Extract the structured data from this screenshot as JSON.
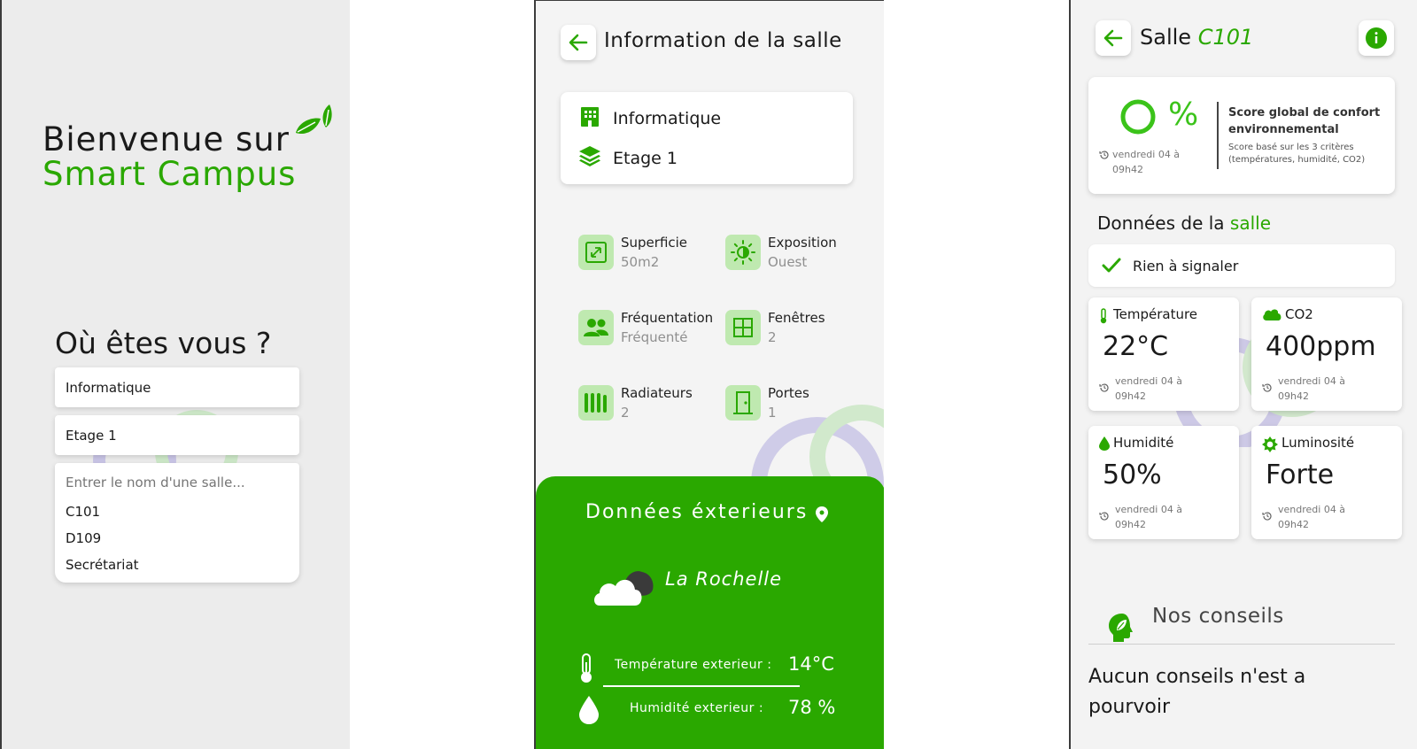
{
  "screen1": {
    "welcome_line1": "Bienvenue sur",
    "welcome_line2": "Smart Campus",
    "question": "Où êtes vous ?",
    "building_value": "Informatique",
    "floor_value": "Etage 1",
    "search_placeholder": "Entrer le nom d'une salle...",
    "options": [
      "C101",
      "D109",
      "Secrétariat"
    ]
  },
  "screen2": {
    "title": "Information de la salle",
    "building": "Informatique",
    "floor": "Etage 1",
    "stats": [
      {
        "label": "Superficie",
        "value": "50m2",
        "icon": "area-icon"
      },
      {
        "label": "Exposition",
        "value": "Ouest",
        "icon": "sun-icon"
      },
      {
        "label": "Fréquentation",
        "value": "Fréquenté",
        "icon": "people-icon"
      },
      {
        "label": "Fenêtres",
        "value": "2",
        "icon": "window-icon"
      },
      {
        "label": "Radiateurs",
        "value": "2",
        "icon": "radiator-icon"
      },
      {
        "label": "Portes",
        "value": "1",
        "icon": "door-icon"
      }
    ],
    "exterior": {
      "title": "Données éxterieurs",
      "city": "La Rochelle",
      "temp_label": "Température exterieur :",
      "temp_value": "14°C",
      "hum_label": "Humidité exterieur :",
      "hum_value": "78 %"
    }
  },
  "screen3": {
    "title_prefix": "Salle",
    "room": "C101",
    "score_symbol": "%",
    "score_time_line1": "vendredi 04 à",
    "score_time_line2": "09h42",
    "score_title": "Score global de confort environnemental",
    "score_subtitle": "Score basé sur les 3 critères (températures, humidité, CO2)",
    "data_title_prefix": "Données de la",
    "data_title_suffix": "salle",
    "status": "Rien à signaler",
    "sensors": [
      {
        "name": "Température",
        "value": "22°C",
        "time1": "vendredi 04 à",
        "time2": "09h42",
        "icon": "thermometer-icon"
      },
      {
        "name": "CO2",
        "value": "400ppm",
        "time1": "vendredi 04 à",
        "time2": "09h42",
        "icon": "cloud-icon"
      },
      {
        "name": "Humidité",
        "value": "50%",
        "time1": "vendredi 04 à",
        "time2": "09h42",
        "icon": "drop-icon"
      },
      {
        "name": "Luminosité",
        "value": "Forte",
        "time1": "vendredi 04 à",
        "time2": "09h42",
        "icon": "brightness-icon"
      }
    ],
    "advice_title": "Nos conseils",
    "advice_text": "Aucun conseils n'est a pourvoir"
  },
  "colors": {
    "accent": "#2aa800",
    "tile": "#bfe9b0",
    "exterior_panel": "#2aa800"
  }
}
